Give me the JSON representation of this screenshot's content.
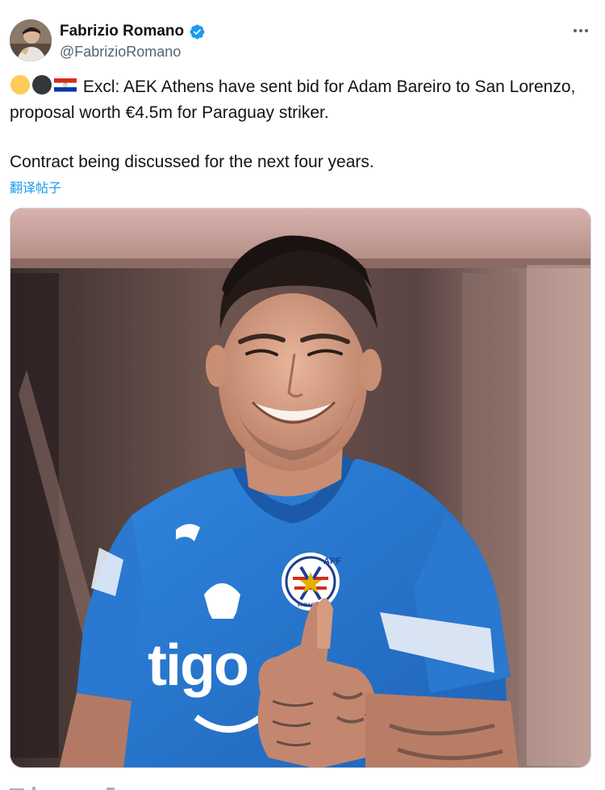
{
  "author": {
    "display_name": "Fabrizio Romano",
    "handle": "@FabrizioRomano",
    "verified": true,
    "avatar_icon": "profile-photo"
  },
  "menu": {
    "icon": "more-horizontal-icon"
  },
  "tweet": {
    "emojis": [
      "yellow-circle",
      "black-circle",
      "paraguay-flag"
    ],
    "paragraph1": "Excl: AEK Athens have sent bid for Adam Bareiro to San Lorenzo, proposal worth €4.5m for Paraguay striker.",
    "paragraph2": "Contract being discussed for the next four years.",
    "translate_label": "翻译帖子"
  },
  "media": {
    "kit": {
      "badge_text": "APF",
      "badge_subtext": "PARAGUAY",
      "sponsor": "tigo"
    }
  },
  "colors": {
    "accent": "#1d9bf0",
    "text": "#0f1419",
    "secondary": "#536471",
    "shirt": "#2f7fd6"
  }
}
